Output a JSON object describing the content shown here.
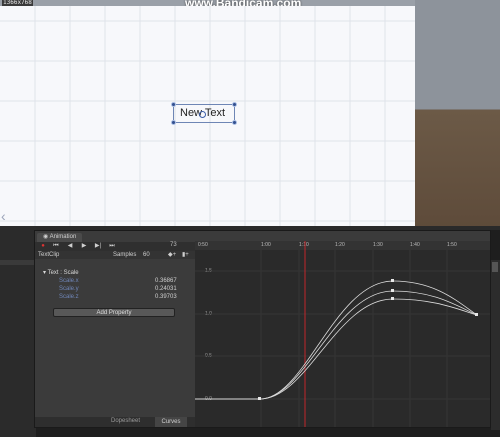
{
  "overlay": {
    "resolution": "1366x768",
    "watermark": "www.Bandicam.com"
  },
  "scene": {
    "text_object_label": "New Text"
  },
  "animation": {
    "tab_title": "Animation",
    "frame": "73",
    "clip_name": "TextClip",
    "samples_label": "Samples",
    "samples_value": "60",
    "root_property": "Text : Scale",
    "properties": [
      {
        "name": "Scale.x",
        "value": "0.36867"
      },
      {
        "name": "Scale.y",
        "value": "0.24031"
      },
      {
        "name": "Scale.z",
        "value": "0.39703"
      }
    ],
    "add_property_label": "Add Property",
    "tabs": {
      "dopesheet": "Dopesheet",
      "curves": "Curves"
    },
    "timeline_labels": [
      "0:50",
      "1:00",
      "1:10",
      "1:20",
      "1:30",
      "1:40",
      "1:50"
    ],
    "y_labels": [
      "1.5",
      "1.0",
      "0.5",
      "0.0"
    ],
    "colors": {
      "playhead": "#c0262b",
      "record": "#d33333"
    }
  }
}
